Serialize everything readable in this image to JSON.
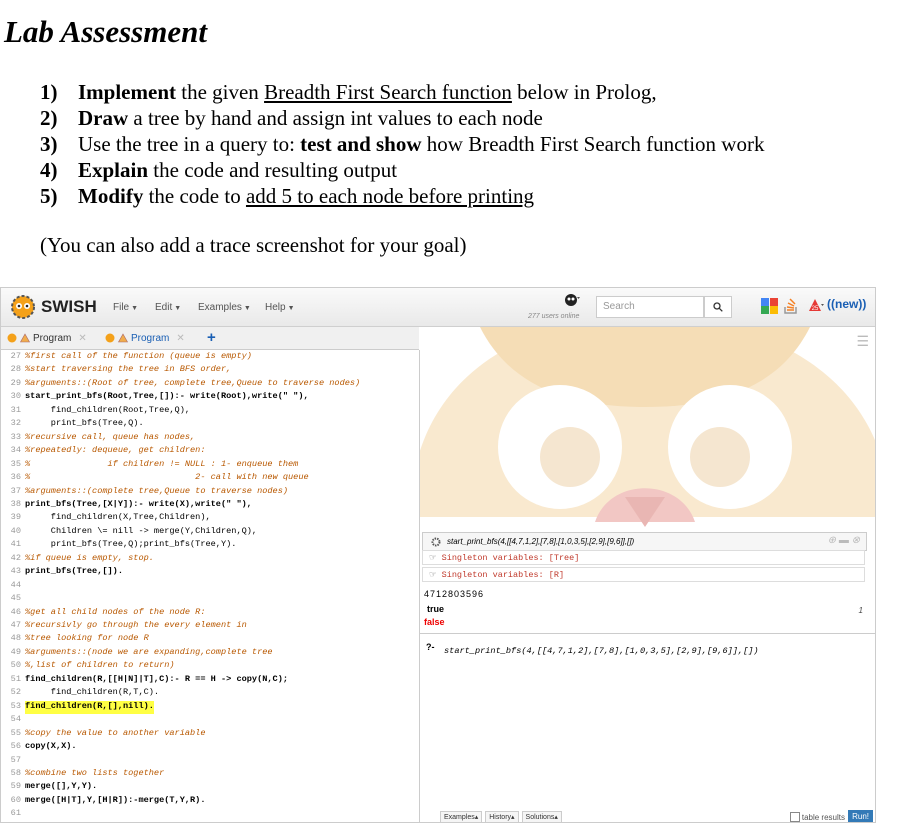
{
  "document": {
    "title": "Lab Assessment",
    "tasks": [
      {
        "num": "1)",
        "bold": "Implement",
        "pre": " the given ",
        "link": "Breadth First Search function",
        "post": " below in Prolog,"
      },
      {
        "num": "2)",
        "bold": "Draw",
        "post": " a tree by hand and assign int values to each node"
      },
      {
        "num": "3)",
        "pre": "Use the tree in a query to: ",
        "bold": "test and show",
        "post": " how Breadth First Search function work"
      },
      {
        "num": "4)",
        "bold": "Explain",
        "post": " the code and resulting output"
      },
      {
        "num": "5)",
        "bold": "Modify",
        "pre": " the code to ",
        "link": "add 5 to each node before printing"
      }
    ],
    "note": "(You can also add a trace screenshot for your goal)"
  },
  "swish": {
    "brand": "SWISH",
    "menus": [
      "File",
      "Edit",
      "Examples",
      "Help"
    ],
    "online": "277 users online",
    "search_placeholder": "Search",
    "new_label": "((new))",
    "tabs": [
      "Program",
      "Program"
    ],
    "query_header": "start_print_bfs(4,[[4,7,1,2],[7,8],[1,0,3,5],[2,9],[9,6]],[])",
    "warnings": [
      "Singleton variables: [Tree]",
      "Singleton variables: [R]"
    ],
    "output": "4712803596",
    "true_label": "true",
    "false_label": "false",
    "result_count": "1",
    "prompt": "?-",
    "query": "start_print_bfs(4,[[4,7,1,2],[7,8],[1,0,3,5],[2,9],[9,6]],[])",
    "bottom_buttons": [
      "Examples",
      "History",
      "Solutions"
    ],
    "table_results": "table results",
    "run": "Run!"
  },
  "code": [
    {
      "n": "27",
      "t": "%first call of the function (queue is empty)"
    },
    {
      "n": "28",
      "t": "%start traversing the tree in BFS order,"
    },
    {
      "n": "29",
      "t": "%arguments::(Root of tree, complete tree,Queue to traverse nodes)"
    },
    {
      "n": "30",
      "t": "start_print_bfs(Root,Tree,[]):- write(Root),write(\" \"),"
    },
    {
      "n": "31",
      "t": "     find_children(Root,Tree,Q),"
    },
    {
      "n": "32",
      "t": "     print_bfs(Tree,Q)."
    },
    {
      "n": "33",
      "t": "%recursive call, queue has nodes,"
    },
    {
      "n": "34",
      "t": "%repeatedly: dequeue, get children:"
    },
    {
      "n": "35",
      "t": "%               if children != NULL : 1- enqueue them"
    },
    {
      "n": "36",
      "t": "%                                2- call with new queue"
    },
    {
      "n": "37",
      "t": "%arguments::(complete tree,Queue to traverse nodes)"
    },
    {
      "n": "38",
      "t": "print_bfs(Tree,[X|Y]):- write(X),write(\" \"),"
    },
    {
      "n": "39",
      "t": "     find_children(X,Tree,Children),"
    },
    {
      "n": "40",
      "t": "     Children \\= nill -> merge(Y,Children,Q),"
    },
    {
      "n": "41",
      "t": "     print_bfs(Tree,Q);print_bfs(Tree,Y)."
    },
    {
      "n": "42",
      "t": "%if queue is empty, stop."
    },
    {
      "n": "43",
      "t": "print_bfs(Tree,[])."
    },
    {
      "n": "44",
      "t": ""
    },
    {
      "n": "45",
      "t": ""
    },
    {
      "n": "46",
      "t": "%get all child nodes of the node R:"
    },
    {
      "n": "47",
      "t": "%recursivly go through the every element in"
    },
    {
      "n": "48",
      "t": "%tree looking for node R"
    },
    {
      "n": "49",
      "t": "%arguments::(node we are expanding,complete tree"
    },
    {
      "n": "50",
      "t": "%,list of children to return)"
    },
    {
      "n": "51",
      "t": "find_children(R,[[H|N]|T],C):- R == H -> copy(N,C);"
    },
    {
      "n": "52",
      "t": "     find_children(R,T,C)."
    },
    {
      "n": "53",
      "t": "find_children(R,[],nill)."
    },
    {
      "n": "54",
      "t": ""
    },
    {
      "n": "55",
      "t": "%copy the value to another variable"
    },
    {
      "n": "56",
      "t": "copy(X,X)."
    },
    {
      "n": "57",
      "t": ""
    },
    {
      "n": "58",
      "t": "%combine two lists together"
    },
    {
      "n": "59",
      "t": "merge([],Y,Y)."
    },
    {
      "n": "60",
      "t": "merge([H|T],Y,[H|R]):-merge(T,Y,R)."
    },
    {
      "n": "61",
      "t": ""
    }
  ]
}
